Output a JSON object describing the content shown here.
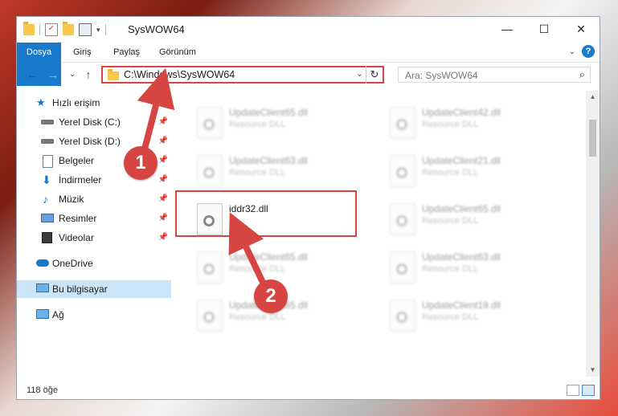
{
  "window": {
    "title": "SysWOW64",
    "buttons": {
      "minimize": "—",
      "maximize": "☐",
      "close": "✕"
    }
  },
  "ribbon": {
    "tabs": [
      "Dosya",
      "Giriş",
      "Paylaş",
      "Görünüm"
    ],
    "help": "?"
  },
  "nav": {
    "back": "←",
    "forward": "→",
    "recent": "⌄",
    "up": "↑"
  },
  "address": {
    "path": "C:\\Windows\\SysWOW64",
    "dropdown": "⌄",
    "refresh": "↻"
  },
  "search": {
    "placeholder": "Ara: SysWOW64",
    "icon": "magnifier-icon"
  },
  "sidebar": {
    "items": [
      {
        "label": "Hızlı erişim",
        "icon": "star-icon",
        "pinned": false
      },
      {
        "label": "Yerel Disk (C:)",
        "icon": "drive-icon",
        "pinned": true
      },
      {
        "label": "Yerel Disk (D:)",
        "icon": "drive-icon",
        "pinned": true
      },
      {
        "label": "Belgeler",
        "icon": "documents-icon",
        "pinned": true
      },
      {
        "label": "İndirmeler",
        "icon": "download-icon",
        "pinned": true
      },
      {
        "label": "Müzik",
        "icon": "music-icon",
        "pinned": true
      },
      {
        "label": "Resimler",
        "icon": "pictures-icon",
        "pinned": true
      },
      {
        "label": "Videolar",
        "icon": "videos-icon",
        "pinned": true
      },
      {
        "label": "OneDrive",
        "icon": "cloud-icon",
        "pinned": false
      },
      {
        "label": "Bu bilgisayar",
        "icon": "computer-icon",
        "pinned": false
      },
      {
        "label": "Ağ",
        "icon": "network-icon",
        "pinned": false
      }
    ],
    "pin_glyph": "📌"
  },
  "files": {
    "left": [
      {
        "name": "UpdateClient65.dll",
        "type": "Resource DLL"
      },
      {
        "name": "UpdateClient63.dll",
        "type": "Resource DLL"
      },
      {
        "name": "iddr32.dll",
        "type": ""
      },
      {
        "name": "UpdateClient65.dll",
        "type": "Resource DLL"
      },
      {
        "name": "UpdateClient65.dll",
        "type": "Resource DLL"
      }
    ],
    "right": [
      {
        "name": "UpdateClient42.dll",
        "type": "Resource DLL"
      },
      {
        "name": "UpdateClient21.dll",
        "type": "Resource DLL"
      },
      {
        "name": "UpdateClient65.dll",
        "type": "Resource DLL"
      },
      {
        "name": "UpdateClient63.dll",
        "type": "Resource DLL"
      },
      {
        "name": "UpdateClient19.dll",
        "type": "Resource DLL"
      }
    ]
  },
  "status": {
    "count": "118 öğe"
  },
  "callouts": {
    "one": "1",
    "two": "2"
  },
  "colors": {
    "accent": "#1979ca",
    "highlight": "#d64541",
    "selected": "#cce4f7"
  }
}
